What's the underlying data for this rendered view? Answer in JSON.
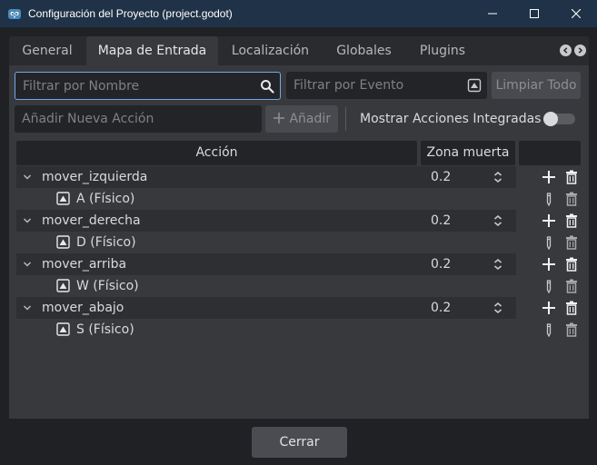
{
  "window": {
    "title": "Configuración del Proyecto (project.godot)"
  },
  "tabs": [
    {
      "label": "General",
      "active": false
    },
    {
      "label": "Mapa de Entrada",
      "active": true
    },
    {
      "label": "Localización",
      "active": false
    },
    {
      "label": "Globales",
      "active": false
    },
    {
      "label": "Plugins",
      "active": false
    }
  ],
  "filters": {
    "name_placeholder": "Filtrar por Nombre",
    "event_placeholder": "Filtrar por Evento",
    "clear_all_label": "Limpiar Todo"
  },
  "add_action": {
    "placeholder": "Añadir Nueva Acción",
    "add_label": "Añadir",
    "show_builtin_label": "Mostrar Acciones Integradas",
    "show_builtin_on": false
  },
  "table": {
    "headers": {
      "action": "Acción",
      "deadzone": "Zona muerta"
    },
    "actions": [
      {
        "name": "mover_izquierda",
        "deadzone": "0.2",
        "event": "A (Físico)"
      },
      {
        "name": "mover_derecha",
        "deadzone": "0.2",
        "event": "D (Físico)"
      },
      {
        "name": "mover_arriba",
        "deadzone": "0.2",
        "event": "W (Físico)"
      },
      {
        "name": "mover_abajo",
        "deadzone": "0.2",
        "event": "S (Físico)"
      }
    ]
  },
  "footer": {
    "close_label": "Cerrar"
  },
  "colors": {
    "titlebar": "#203247",
    "focus_border": "#6fa8e8",
    "accent_icon": "#478cbf"
  }
}
